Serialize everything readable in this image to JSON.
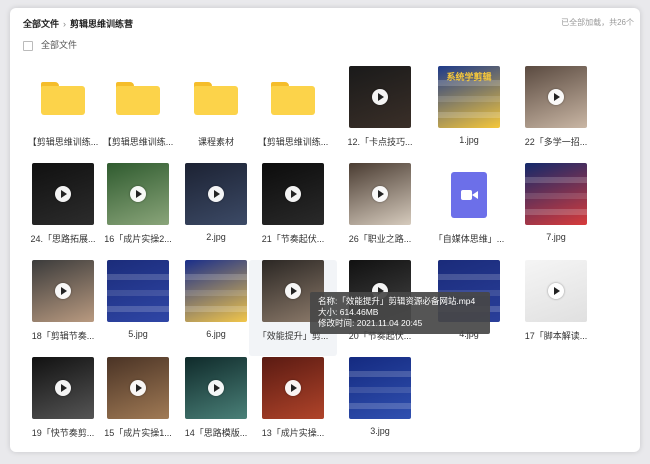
{
  "breadcrumb": {
    "root": "全部文件",
    "current": "剪辑思维训练营"
  },
  "status_text": "已全部加载，共26个",
  "select_all_label": "全部文件",
  "tooltip": {
    "name": "名称:「效能提升」剪辑资源必备网站.mp4",
    "size": "大小: 614.46MB",
    "modified": "修改时间: 2021.11.04 20:45"
  },
  "items": [
    {
      "label": "【剪辑思维训练...",
      "kind": "folder"
    },
    {
      "label": "【剪辑思维训练...",
      "kind": "folder"
    },
    {
      "label": "课程素材",
      "kind": "folder"
    },
    {
      "label": "【剪辑思维训练...",
      "kind": "folder"
    },
    {
      "label": "12.「卡点技巧...",
      "kind": "video",
      "colors": [
        "#1a1a1a",
        "#3a2f28"
      ]
    },
    {
      "label": "1.jpg",
      "kind": "image",
      "colors": [
        "#1e3a8a",
        "#f5c73b"
      ],
      "overlay_text": "系统学剪辑"
    },
    {
      "label": "22「多学一招...",
      "kind": "video",
      "colors": [
        "#5a4a40",
        "#c9b6a4"
      ]
    },
    {
      "label": "24.「思路拓展...",
      "kind": "video",
      "colors": [
        "#101010",
        "#2c2c2c"
      ]
    },
    {
      "label": "16「成片实操2...",
      "kind": "video",
      "colors": [
        "#2f5b2f",
        "#8aa57a"
      ]
    },
    {
      "label": "2.jpg",
      "kind": "image-play",
      "colors": [
        "#1c2233",
        "#3c4a66"
      ]
    },
    {
      "label": "21「节奏起伏...",
      "kind": "video",
      "colors": [
        "#0c0c0c",
        "#2a2a2a"
      ]
    },
    {
      "label": "26「职业之路...",
      "kind": "video",
      "colors": [
        "#4a3c32",
        "#d6cbbd"
      ]
    },
    {
      "label": "「自媒体思维」...",
      "kind": "videofile"
    },
    {
      "label": "7.jpg",
      "kind": "image",
      "colors": [
        "#13296b",
        "#d83b3b"
      ]
    },
    {
      "label": "18「剪辑节奏...",
      "kind": "video",
      "colors": [
        "#3b3b3b",
        "#b99a80"
      ]
    },
    {
      "label": "5.jpg",
      "kind": "image",
      "colors": [
        "#1b2c7a",
        "#2f46a6"
      ]
    },
    {
      "label": "6.jpg",
      "kind": "image",
      "colors": [
        "#1a2e8a",
        "#f2c64a"
      ]
    },
    {
      "label": "「效能提升」剪...",
      "kind": "video",
      "colors": [
        "#2b2724",
        "#8c7a6a"
      ]
    },
    {
      "label": "20「节奏起伏...",
      "kind": "video",
      "colors": [
        "#111",
        "#444"
      ]
    },
    {
      "label": "4.jpg",
      "kind": "image",
      "colors": [
        "#1a2b7a",
        "#2a3f9a"
      ]
    },
    {
      "label": "17「脚本解读...",
      "kind": "doc-play",
      "colors": [
        "#f5f5f5",
        "#e0e0e0"
      ]
    },
    {
      "label": "19「快节奏剪...",
      "kind": "video",
      "colors": [
        "#111",
        "#555"
      ]
    },
    {
      "label": "15「成片实操1...",
      "kind": "video",
      "colors": [
        "#4a3325",
        "#a07a55"
      ]
    },
    {
      "label": "14「思路模版...",
      "kind": "video",
      "colors": [
        "#0f2a2a",
        "#4a8078"
      ]
    },
    {
      "label": "13「成片实操...",
      "kind": "video",
      "colors": [
        "#5a1a12",
        "#b0442a"
      ]
    },
    {
      "label": "3.jpg",
      "kind": "image",
      "colors": [
        "#142a80",
        "#3050b0"
      ]
    }
  ]
}
